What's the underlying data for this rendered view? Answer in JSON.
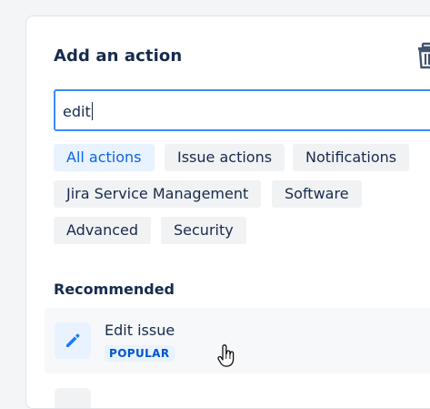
{
  "dialog": {
    "title": "Add an action",
    "delete_icon": "trash-icon"
  },
  "search": {
    "value": "edit",
    "placeholder": ""
  },
  "filters": [
    {
      "label": "All actions",
      "active": true
    },
    {
      "label": "Issue actions",
      "active": false
    },
    {
      "label": "Notifications",
      "active": false
    },
    {
      "label": "Jira Service Management",
      "active": false
    },
    {
      "label": "Software",
      "active": false
    },
    {
      "label": "Advanced",
      "active": false
    },
    {
      "label": "Security",
      "active": false
    }
  ],
  "recommended": {
    "heading": "Recommended",
    "items": [
      {
        "title": "Edit issue",
        "badge": "POPULAR",
        "icon": "pencil-icon"
      }
    ]
  },
  "colors": {
    "accent": "#0c66e4",
    "focus_border": "#388bff",
    "chip_bg": "#f1f2f4",
    "chip_active_bg": "#e9f2ff",
    "text": "#172b4d"
  }
}
